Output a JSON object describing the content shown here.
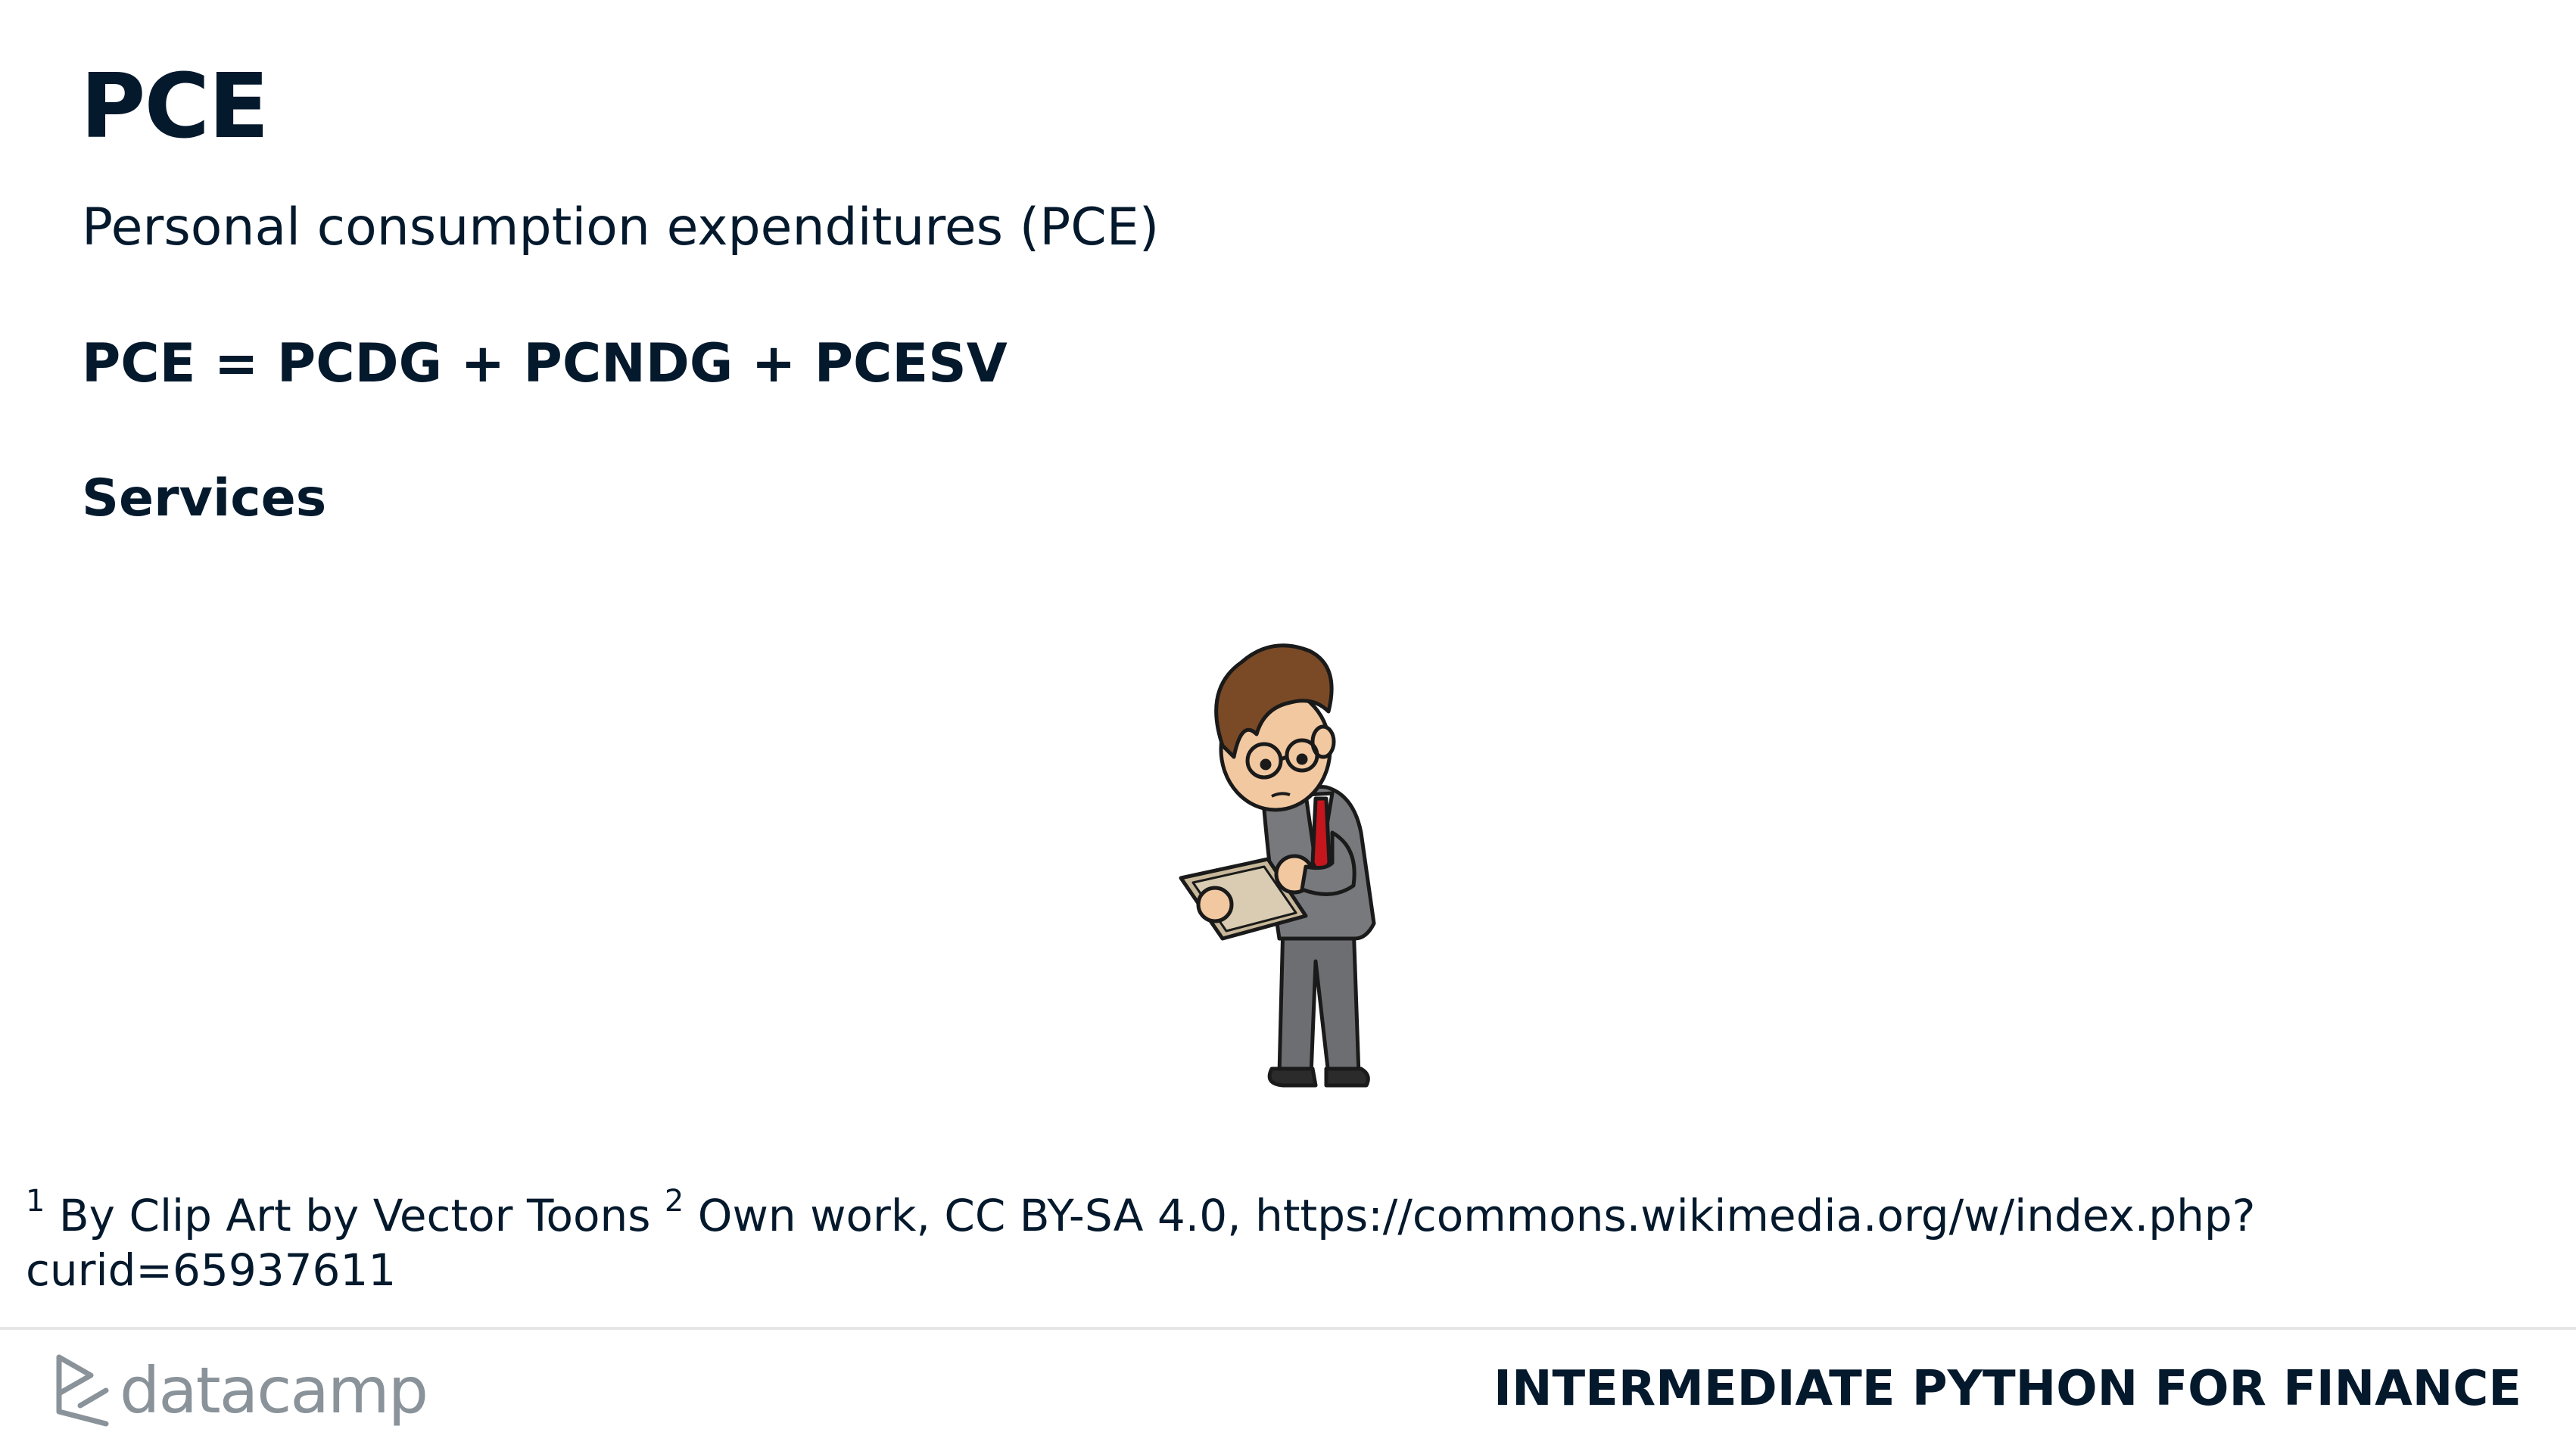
{
  "slide": {
    "title": "PCE",
    "subtitle": "Personal consumption expenditures (PCE)",
    "formula": "PCE = PCDG + PCNDG + PCESV",
    "section": "Services"
  },
  "illustration": {
    "icon": "businessman-with-tablet-icon"
  },
  "footnote": {
    "marker1": "1",
    "text1": " By Clip Art by Vector Toons ",
    "marker2": "2",
    "text2": " Own work, CC BY-SA 4.0, https://commons.wikimedia.org/w/index.php?curid=65937611"
  },
  "footer": {
    "logo_text": "datacamp",
    "course_title": "INTERMEDIATE PYTHON FOR FINANCE"
  },
  "colors": {
    "text": "#05192d",
    "logo_gray": "#8a939a",
    "divider": "#e6e6e6"
  }
}
